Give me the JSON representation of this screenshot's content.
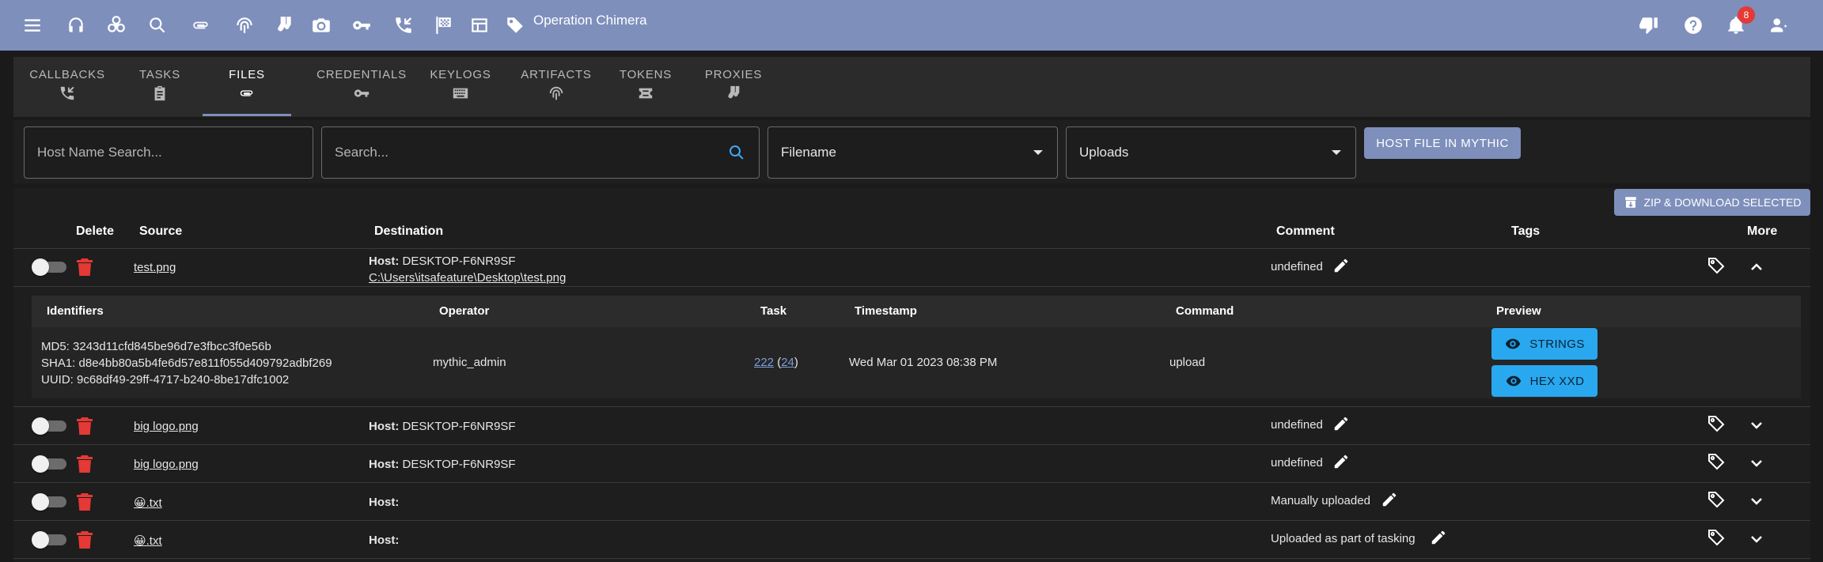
{
  "operation": {
    "name": "Operation Chimera",
    "notification_count": "8"
  },
  "colors": {
    "topbar": "#7e8fbc",
    "accent_blue": "#29a8f0",
    "delete_red": "#e53935"
  },
  "tabs": [
    {
      "label": "CALLBACKS",
      "icon": "phone-callback-icon"
    },
    {
      "label": "TASKS",
      "icon": "clipboard-icon"
    },
    {
      "label": "FILES",
      "icon": "paperclip-icon",
      "active": true
    },
    {
      "label": "CREDENTIALS",
      "icon": "key-icon"
    },
    {
      "label": "KEYLOGS",
      "icon": "keyboard-icon"
    },
    {
      "label": "ARTIFACTS",
      "icon": "fingerprint-icon"
    },
    {
      "label": "TOKENS",
      "icon": "ticket-icon"
    },
    {
      "label": "PROXIES",
      "icon": "socks-icon"
    }
  ],
  "filters": {
    "host_placeholder": "Host Name Search...",
    "search_placeholder": "Search...",
    "field_select": "Filename",
    "type_select": "Uploads",
    "host_button": "HOST FILE IN MYTHIC"
  },
  "table": {
    "zip_button": "ZIP & DOWNLOAD SELECTED",
    "headers": {
      "delete": "Delete",
      "source": "Source",
      "destination": "Destination",
      "comment": "Comment",
      "tags": "Tags",
      "more": "More"
    },
    "host_label": "Host:",
    "rows": [
      {
        "source": "test.png",
        "host": "DESKTOP-F6NR9SF",
        "path": "C:\\Users\\itsafeature\\Desktop\\test.png",
        "comment": "undefined",
        "expanded": true
      },
      {
        "source": "big logo.png",
        "host": "DESKTOP-F6NR9SF",
        "path": "",
        "comment": "undefined"
      },
      {
        "source": "big logo.png",
        "host": "DESKTOP-F6NR9SF",
        "path": "",
        "comment": "undefined"
      },
      {
        "source": "😀.txt",
        "host": "",
        "path": "",
        "comment": "Manually uploaded"
      },
      {
        "source": "😀.txt",
        "host": "",
        "path": "",
        "comment": "Uploaded as part of tasking"
      }
    ]
  },
  "detail": {
    "headers": {
      "identifiers": "Identifiers",
      "operator": "Operator",
      "task": "Task",
      "timestamp": "Timestamp",
      "command": "Command",
      "preview": "Preview"
    },
    "md5": "MD5: 3243d11cfd845be96d7e3fbcc3f0e56b",
    "sha1": "SHA1: d8e4bb80a5b4fe6d57e811f055d409792adbf269",
    "uuid": "UUID: 9c68df49-29ff-4717-b240-8be17dfc1002",
    "operator": "mythic_admin",
    "task_id": "222",
    "callback_id": "24",
    "timestamp": "Wed Mar 01 2023 08:38 PM",
    "command": "upload",
    "strings_button": "STRINGS",
    "hex_button": "HEX XXD"
  }
}
